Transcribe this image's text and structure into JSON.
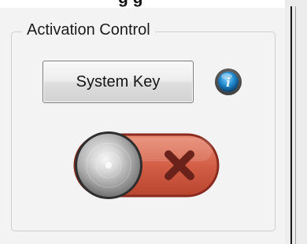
{
  "header": {
    "title_fragment": "g g"
  },
  "group": {
    "title": "Activation Control"
  },
  "buttons": {
    "system_key_label": "System Key"
  },
  "info": {
    "icon": "info-icon",
    "glyph": "i"
  },
  "toggle": {
    "state": "off",
    "off_icon": "close-icon",
    "knob_icon": "brushed-metal-knob",
    "colors": {
      "track": "#d45f47",
      "track_border": "#8b2a1e",
      "x_mark": "#6a221a",
      "info_blue": "#1e86c8"
    }
  }
}
